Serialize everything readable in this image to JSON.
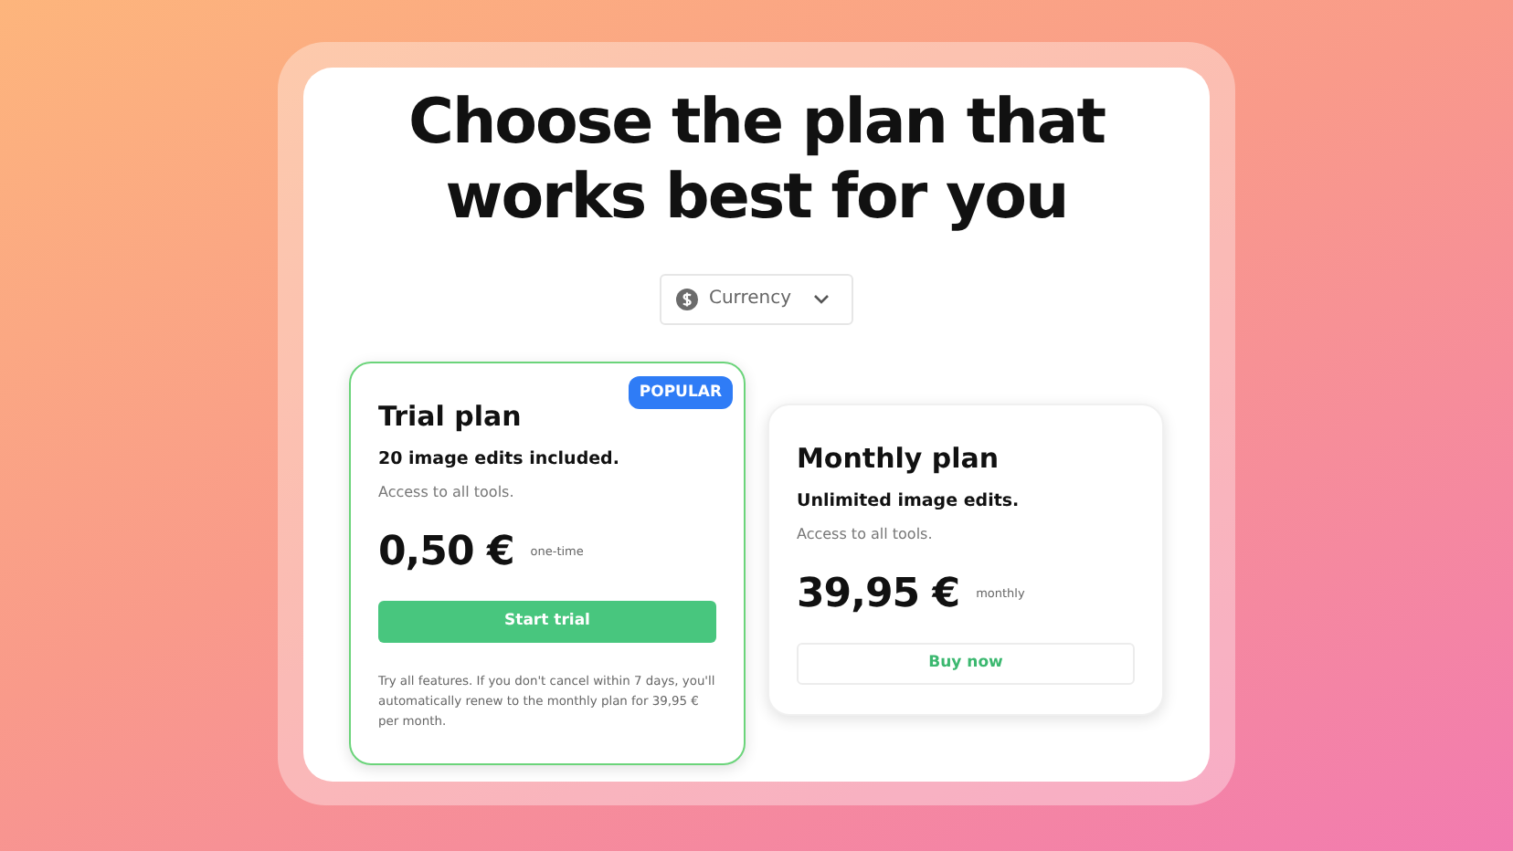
{
  "heading": "Choose the plan that works best for you",
  "currency": {
    "label": "Currency"
  },
  "plans": [
    {
      "name": "Trial plan",
      "highlighted": true,
      "badge": "POPULAR",
      "headline": "20 image edits included.",
      "subline": "Access to all tools.",
      "price": "0,50 €",
      "period": "one-time",
      "button": {
        "label": "Start trial",
        "kind": "primary"
      },
      "note": "Try all features. If you don't cancel within 7 days, you'll automatically renew to the monthly plan for 39,95 € per month."
    },
    {
      "name": "Monthly plan",
      "highlighted": false,
      "headline": "Unlimited image edits.",
      "subline": "Access to all tools.",
      "price": "39,95 €",
      "period": "monthly",
      "button": {
        "label": "Buy now",
        "kind": "outline"
      }
    }
  ]
}
